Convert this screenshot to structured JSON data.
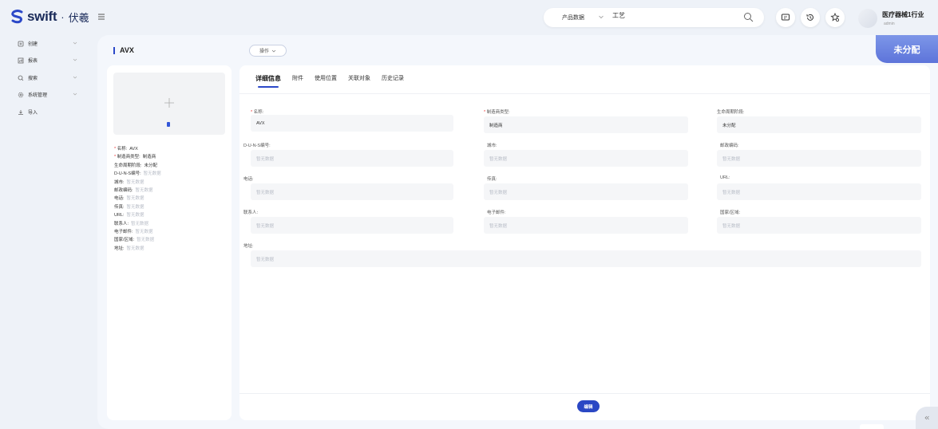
{
  "app": {
    "logo_text": "swift",
    "logo_separator": "·",
    "logo_cn": "伏羲",
    "brand_color": "#2b48c8"
  },
  "header": {
    "search_scope": "产品数据",
    "search_value": "工艺",
    "org_name": "医疗器械1行业",
    "user_name": "admin",
    "icons": [
      "menu-toggle-icon",
      "search-icon",
      "message-icon",
      "history-icon",
      "favorite-settings-icon"
    ]
  },
  "sidebar": {
    "items": [
      {
        "label": "创建",
        "icon": "create-icon",
        "has_children": true
      },
      {
        "label": "报表",
        "icon": "report-icon",
        "has_children": true
      },
      {
        "label": "搜索",
        "icon": "search-icon",
        "has_children": true
      },
      {
        "label": "系统管理",
        "icon": "settings-icon",
        "has_children": true
      },
      {
        "label": "导入",
        "icon": "import-icon",
        "has_children": false
      }
    ]
  },
  "page": {
    "title": "AVX",
    "ops_button": "操作",
    "status": "未分配"
  },
  "summary": {
    "rows": [
      {
        "label": "名称:",
        "value": "AVX",
        "required": true,
        "empty": false
      },
      {
        "label": "制造商类型:",
        "value": "制造商",
        "required": true,
        "empty": false
      },
      {
        "label": "生命周期阶段:",
        "value": "未分配",
        "required": false,
        "empty": false
      },
      {
        "label": "D-U-N-S编号:",
        "value": "暂无数据",
        "required": false,
        "empty": true
      },
      {
        "label": "城市:",
        "value": "暂无数据",
        "required": false,
        "empty": true
      },
      {
        "label": "邮政编码:",
        "value": "暂无数据",
        "required": false,
        "empty": true
      },
      {
        "label": "电话:",
        "value": "暂无数据",
        "required": false,
        "empty": true
      },
      {
        "label": "传真:",
        "value": "暂无数据",
        "required": false,
        "empty": true
      },
      {
        "label": "URL:",
        "value": "暂无数据",
        "required": false,
        "empty": true
      },
      {
        "label": "联系人:",
        "value": "暂无数据",
        "required": false,
        "empty": true
      },
      {
        "label": "电子邮件:",
        "value": "暂无数据",
        "required": false,
        "empty": true
      },
      {
        "label": "国家/区域:",
        "value": "暂无数据",
        "required": false,
        "empty": true
      },
      {
        "label": "地址:",
        "value": "暂无数据",
        "required": false,
        "empty": true
      }
    ]
  },
  "tabs": [
    "详细信息",
    "附件",
    "使用位置",
    "关联对象",
    "历史记录"
  ],
  "details": {
    "fields": [
      {
        "label": "名称:",
        "value": "AVX",
        "required": true,
        "empty": false
      },
      {
        "label": "制造商类型:",
        "value": "制造商",
        "required": true,
        "empty": false
      },
      {
        "label": "生命周期阶段:",
        "value": "未分配",
        "required": false,
        "empty": false
      },
      {
        "label": "D-U-N-S编号:",
        "value": "暂无数据",
        "required": false,
        "empty": true
      },
      {
        "label": "城市:",
        "value": "暂无数据",
        "required": false,
        "empty": true
      },
      {
        "label": "邮政编码:",
        "value": "暂无数据",
        "required": false,
        "empty": true
      },
      {
        "label": "电话:",
        "value": "暂无数据",
        "required": false,
        "empty": true
      },
      {
        "label": "传真:",
        "value": "暂无数据",
        "required": false,
        "empty": true
      },
      {
        "label": "URL:",
        "value": "暂无数据",
        "required": false,
        "empty": true
      },
      {
        "label": "联系人:",
        "value": "暂无数据",
        "required": false,
        "empty": true
      },
      {
        "label": "电子邮件:",
        "value": "暂无数据",
        "required": false,
        "empty": true
      },
      {
        "label": "国家/区域:",
        "value": "暂无数据",
        "required": false,
        "empty": true
      },
      {
        "label": "地址:",
        "value": "暂无数据",
        "required": false,
        "empty": true
      }
    ],
    "edit_button": "编辑"
  }
}
